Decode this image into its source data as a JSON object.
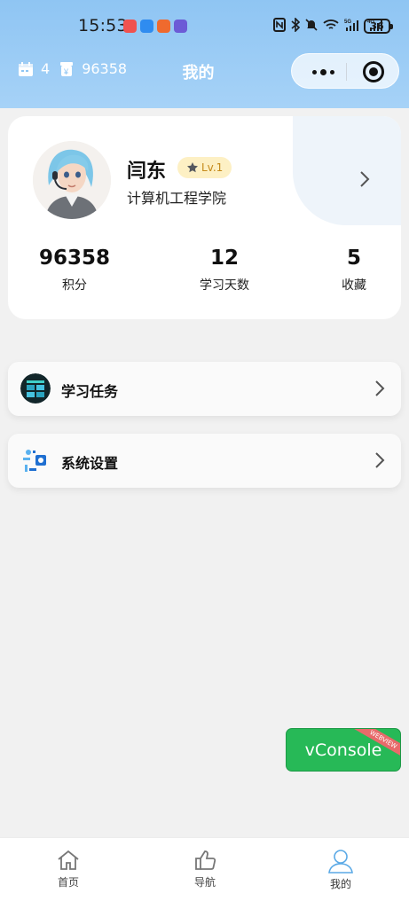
{
  "status_bar": {
    "time": "15:53",
    "battery": "36"
  },
  "nav": {
    "title": "我的",
    "days_count": "4",
    "points": "96358"
  },
  "profile": {
    "name": "闫东",
    "level": "Lv.1",
    "college": "计算机工程学院"
  },
  "stats": [
    {
      "value": "96358",
      "label": "积分"
    },
    {
      "value": "12",
      "label": "学习天数"
    },
    {
      "value": "5",
      "label": "收藏"
    }
  ],
  "menu": [
    {
      "label": "学习任务",
      "icon": "study-task-icon"
    },
    {
      "label": "系统设置",
      "icon": "system-settings-icon"
    }
  ],
  "vconsole": {
    "label": "vConsole",
    "ribbon": "WEBVIEW"
  },
  "tabbar": [
    {
      "label": "首页",
      "icon": "home-icon"
    },
    {
      "label": "导航",
      "icon": "thumbs-up-icon"
    },
    {
      "label": "我的",
      "icon": "person-icon"
    }
  ],
  "colors": {
    "header_gradient_top": "#8fc5f3",
    "header_gradient_bottom": "#a6d2f7",
    "vconsole_green": "#27b957",
    "level_badge_bg": "#fdf0c4",
    "tab_active": "#5aa9e6"
  }
}
